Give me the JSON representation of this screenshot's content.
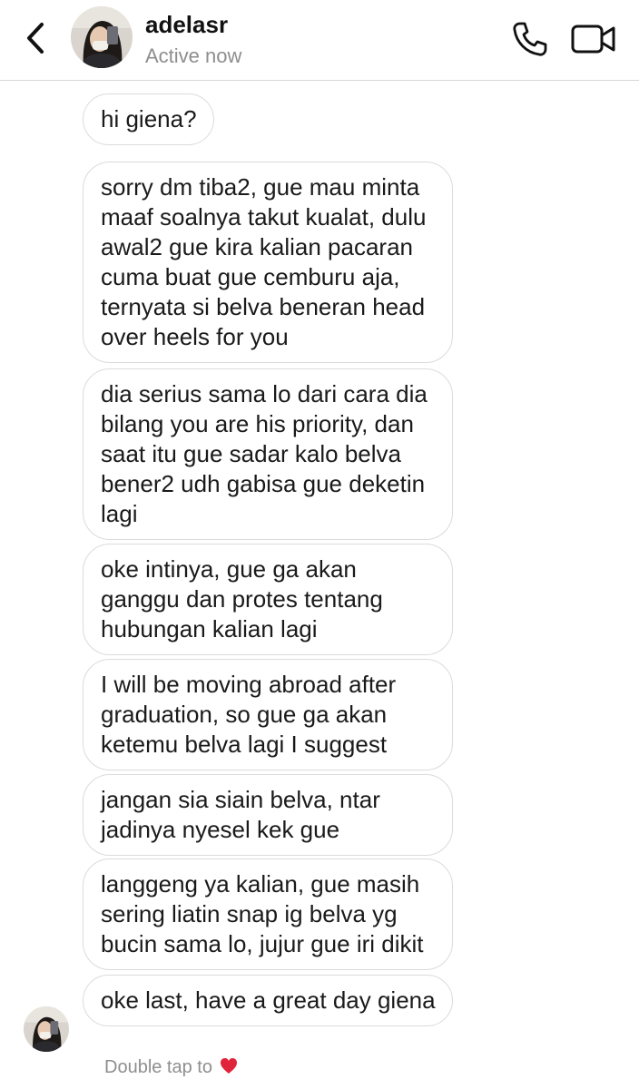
{
  "header": {
    "username": "adelasr",
    "status": "Active now"
  },
  "icons": {
    "back": "chevron-left-icon",
    "call": "phone-icon",
    "video": "video-camera-icon",
    "heart": "heart-icon"
  },
  "colors": {
    "heart": "#e0243b",
    "muted_text": "#8e8e8e",
    "bubble_border": "#dbdbdb"
  },
  "messages": [
    {
      "text": "hi giena?"
    },
    {
      "text": "sorry dm tiba2, gue mau minta maaf soalnya takut kualat, dulu awal2 gue kira kalian pacaran cuma buat gue cemburu aja, ternyata si belva beneran head over heels for you"
    },
    {
      "text": "dia serius sama lo dari cara dia bilang you are his priority, dan saat itu gue sadar kalo belva bener2 udh gabisa gue deketin lagi"
    },
    {
      "text": "oke intinya, gue ga akan ganggu dan protes tentang hubungan kalian lagi"
    },
    {
      "text": "I will be moving abroad after graduation, so gue ga akan ketemu belva lagi I suggest"
    },
    {
      "text": "jangan sia siain belva, ntar jadinya nyesel kek gue"
    },
    {
      "text": "langgeng ya kalian, gue masih sering liatin snap ig belva yg bucin sama lo, jujur gue iri dikit"
    },
    {
      "text": "oke last, have a great day giena"
    }
  ],
  "footer": {
    "hint": "Double tap to"
  }
}
